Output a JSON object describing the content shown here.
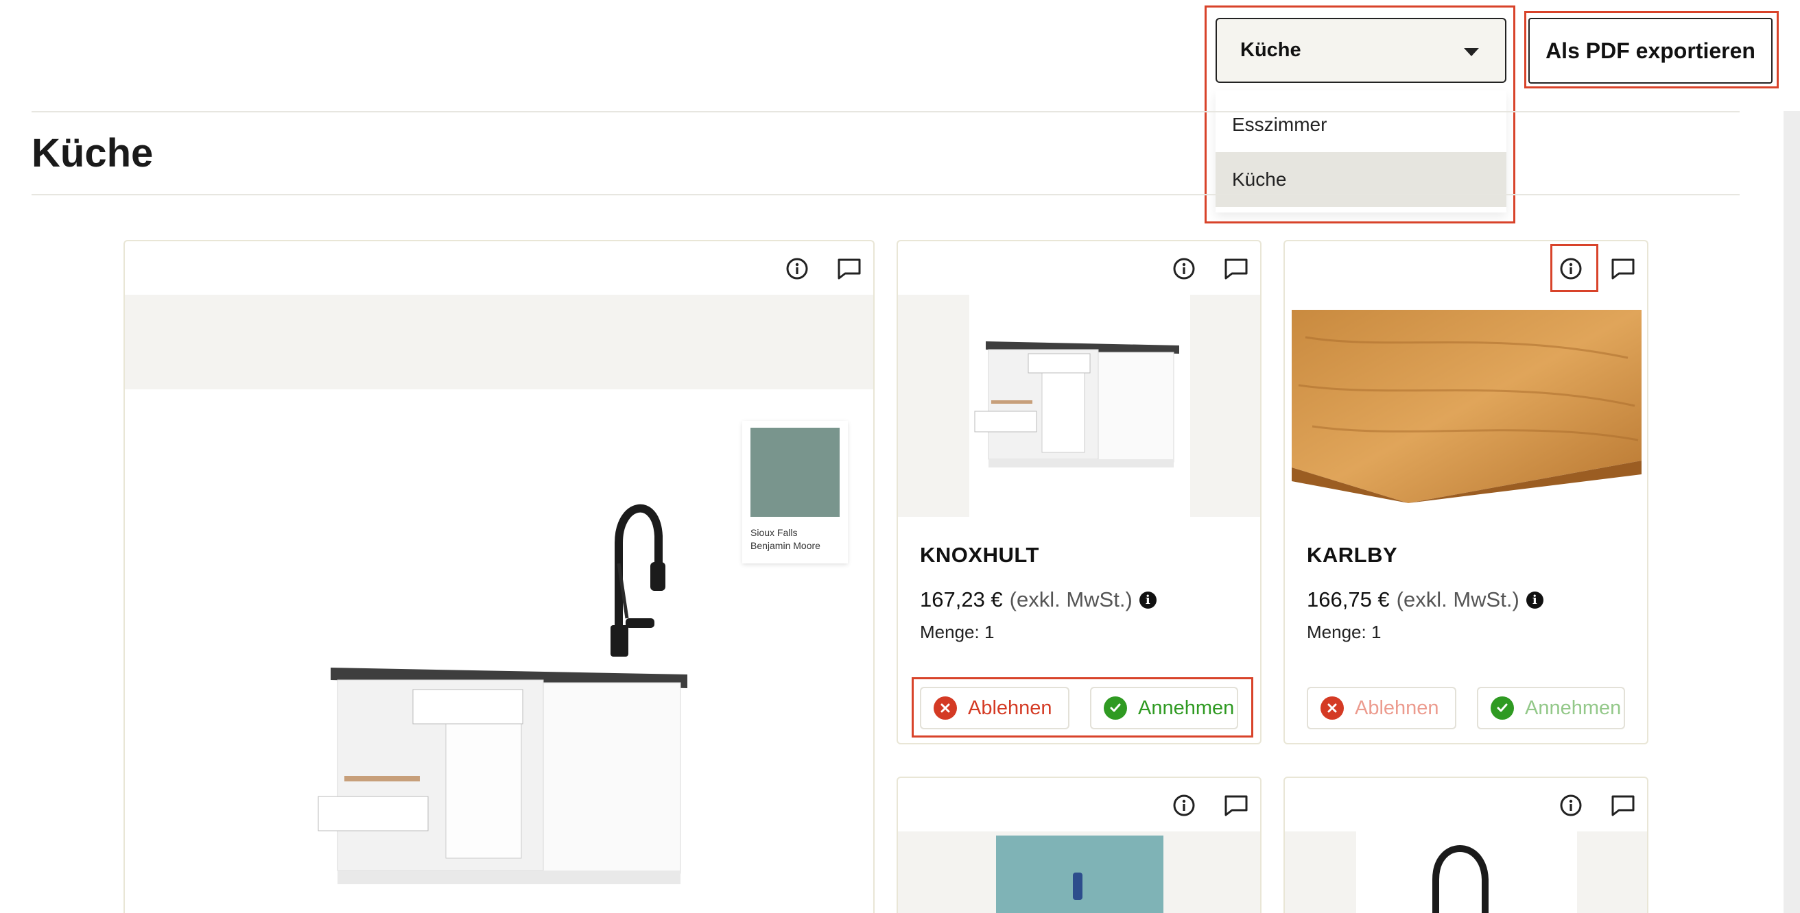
{
  "room_selector": {
    "selected": "Küche",
    "options": [
      "Esszimmer",
      "Küche"
    ]
  },
  "export_label": "Als PDF exportieren",
  "page_title": "Küche",
  "moodboard": {
    "swatch_name": "Sioux Falls",
    "swatch_brand": "Benjamin Moore"
  },
  "products": [
    {
      "name": "KNOXHULT",
      "price": "167,23 €",
      "vat": "(exkl. MwSt.)",
      "quantity": "Menge: 1",
      "reject_label": "Ablehnen",
      "accept_label": "Annehmen"
    },
    {
      "name": "KARLBY",
      "price": "166,75 €",
      "vat": "(exkl. MwSt.)",
      "quantity": "Menge: 1",
      "reject_label": "Ablehnen",
      "accept_label": "Annehmen"
    }
  ],
  "colors": {
    "highlight": "#d8432a",
    "reject": "#d43a24",
    "accept": "#2f9a22",
    "card_border": "#e9e6d6",
    "swatch": "#79958d"
  }
}
